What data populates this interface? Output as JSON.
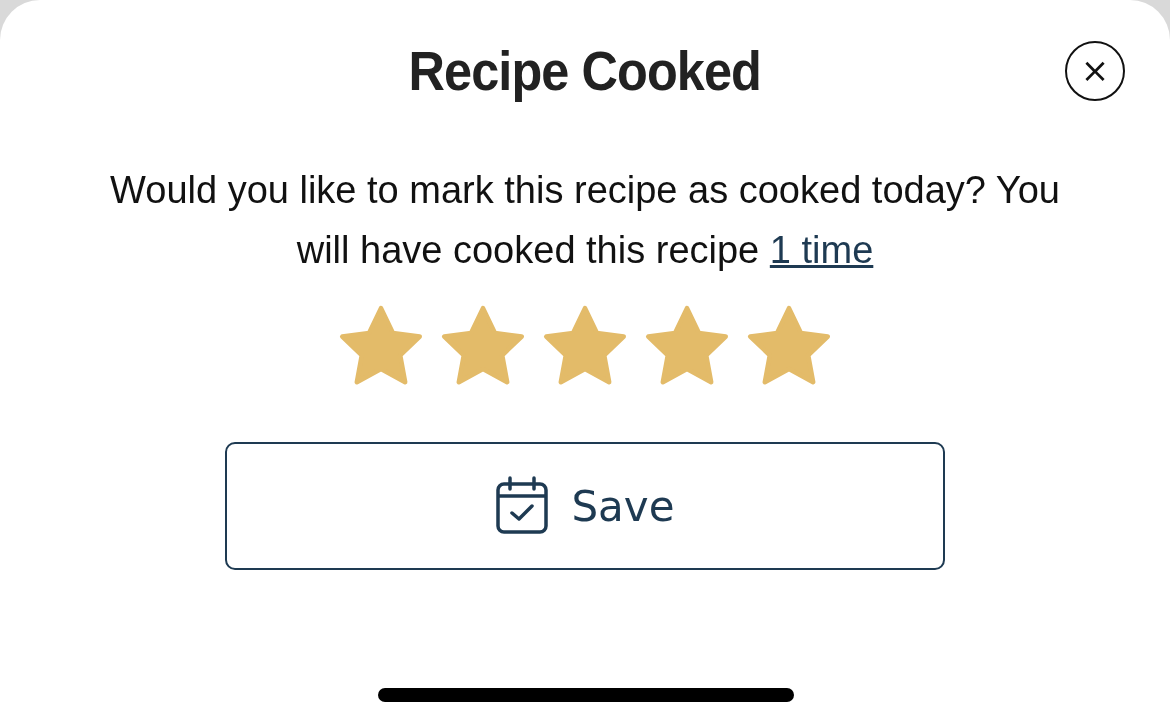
{
  "dialog": {
    "title": "Recipe Cooked",
    "close_icon": "×",
    "message": {
      "text": "Would you like to mark this recipe as cooked today? You will have cooked this recipe",
      "link": "1 time"
    },
    "rating": {
      "stars": 5
    },
    "save_button": {
      "label": "Save"
    }
  }
}
